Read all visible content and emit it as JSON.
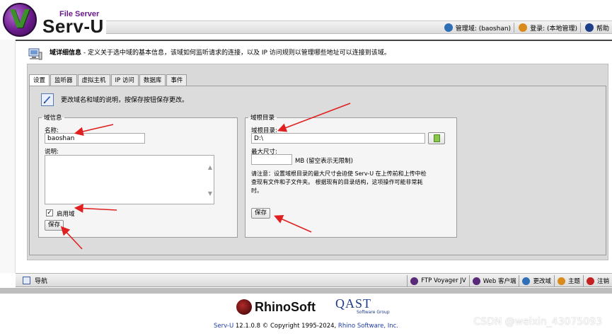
{
  "header": {
    "brand_small": "File Server",
    "brand_large": "Serv-U",
    "links": [
      {
        "label": "管理域: (baoshan)",
        "icon": "domain-globe-icon",
        "color": "#2f6fb6"
      },
      {
        "label": "登录: (本地管理)",
        "icon": "user-login-icon",
        "color": "#d98b1c"
      },
      {
        "label": "帮助",
        "icon": "help-icon",
        "color": "#1f3f8a"
      }
    ]
  },
  "intro": {
    "title": "域详细信息",
    "text": " - 定义关于选中域的基本信息，该域如何监听请求的连接，以及 IP 访问规则以管理哪些地址可以连接到该域。"
  },
  "tabs": [
    {
      "label": "设置",
      "active": true
    },
    {
      "label": "监听器",
      "active": false
    },
    {
      "label": "虚拟主机",
      "active": false
    },
    {
      "label": "IP 访问",
      "active": false
    },
    {
      "label": "数据库",
      "active": false
    },
    {
      "label": "事件",
      "active": false
    }
  ],
  "settings": {
    "description": "更改域名和域的说明，按保存按钮保存更改。",
    "domain_info": {
      "legend": "域信息",
      "name_label": "名称:",
      "name_value": "baoshan",
      "desc_label": "说明:",
      "desc_value": "",
      "enable_label": "启用域",
      "enable_checked": true,
      "save_label": "保存"
    },
    "domain_root": {
      "legend": "域根目录",
      "root_label": "域根目录:",
      "root_value": "D:\\",
      "max_size_label": "最大尺寸:",
      "max_size_value": "",
      "max_size_unit": "MB (留空表示无限制)",
      "note": "请注意：设置域根目录的最大尺寸会迫使 Serv-U 在上传前和上传中检查现有文件和子文件夹。 根据现有的目录结构，这项操作可能非常耗时。",
      "save_label": "保存"
    }
  },
  "toolbar": {
    "nav_label": "导航",
    "items": [
      {
        "label": "FTP Voyager JV",
        "icon": "ftp-voyager-icon",
        "color": "#5a2a7a"
      },
      {
        "label": "Web 客户端",
        "icon": "web-client-icon",
        "color": "#5a2a7a"
      },
      {
        "label": "更改域",
        "icon": "change-domain-icon",
        "color": "#2f6fb6"
      },
      {
        "label": "主题",
        "icon": "theme-icon",
        "color": "#d98b1c"
      },
      {
        "label": "注销",
        "icon": "logout-icon",
        "color": "#c42020"
      }
    ]
  },
  "footer": {
    "rhino": "RhinoSoft",
    "qast": "QAST",
    "qast_sub": "Software Group",
    "copyright_product": "Serv-U",
    "copyright_middle": " 12.1.0.8 © Copyright 1995-2024, ",
    "copyright_company": "Rhino Software, Inc.",
    "watermark": "CSDN @weixin_43075093"
  }
}
